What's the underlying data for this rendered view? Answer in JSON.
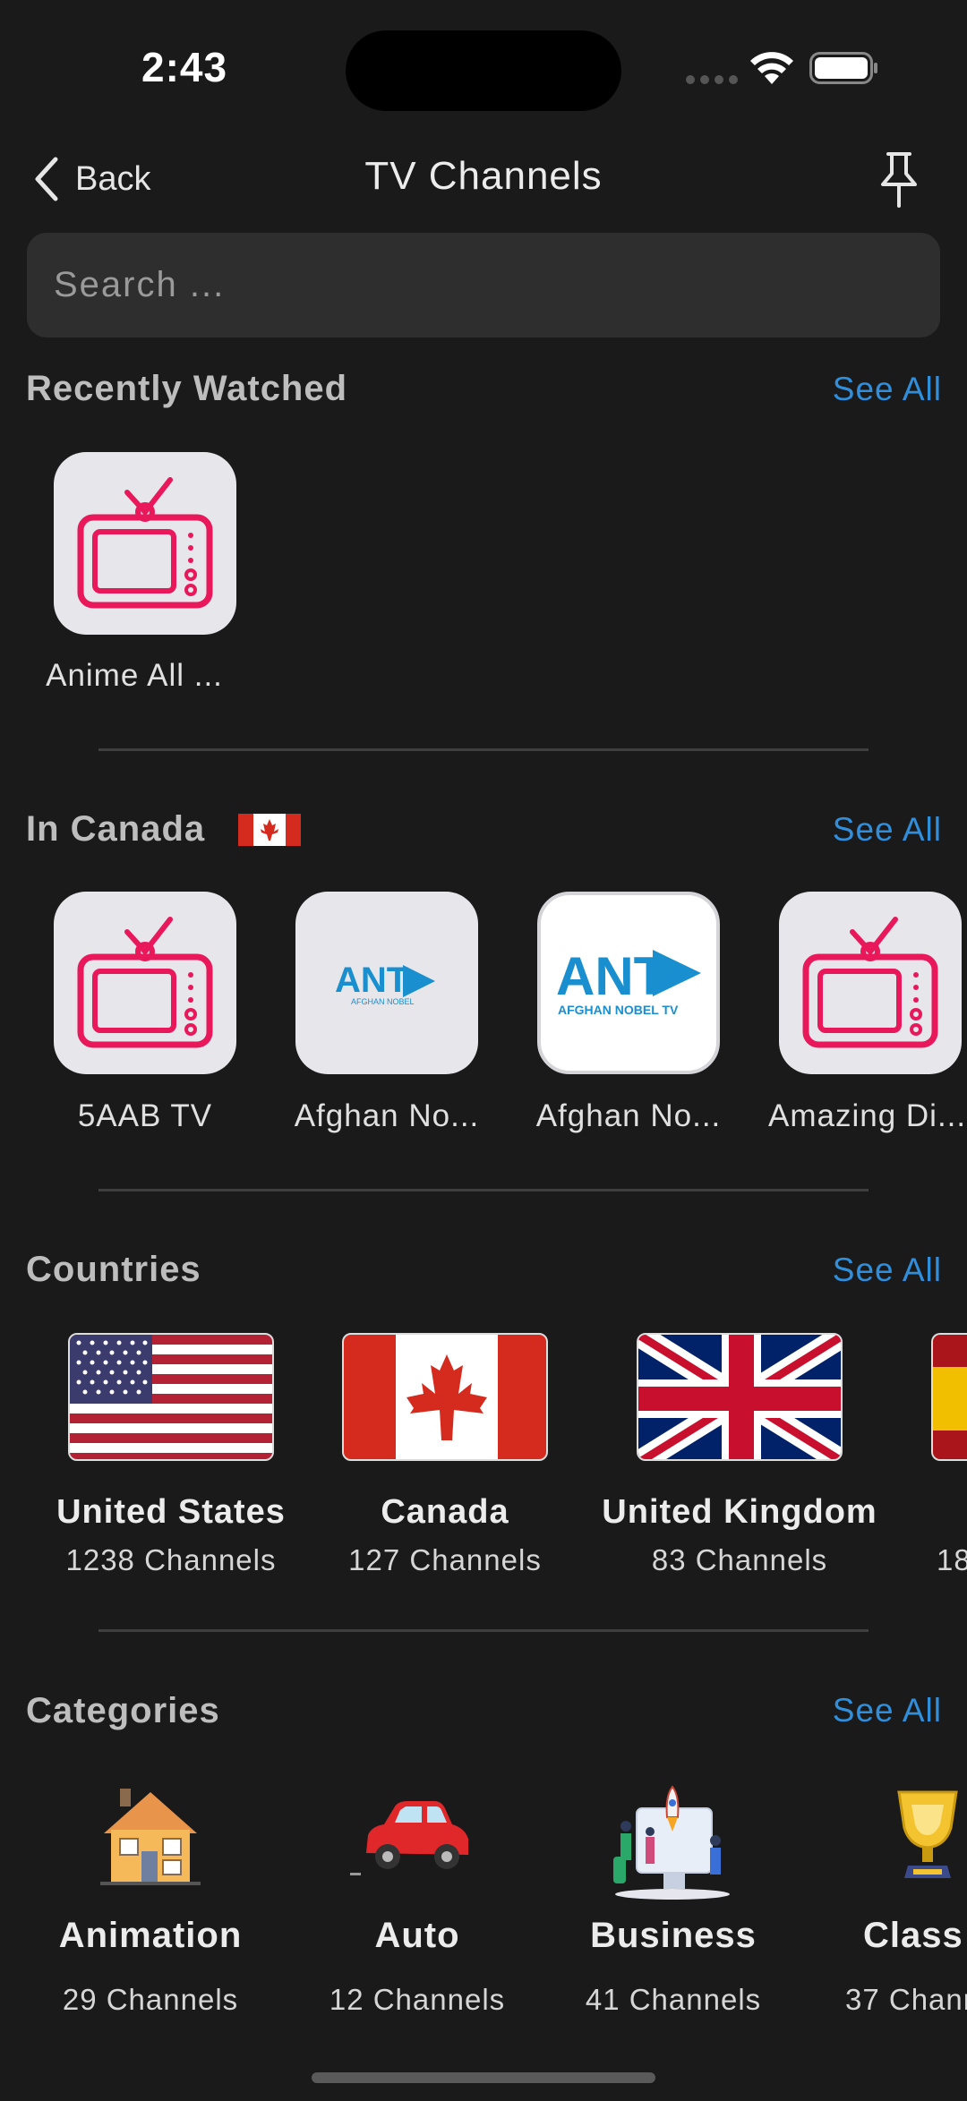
{
  "status": {
    "time": "2:43"
  },
  "nav": {
    "back_label": "Back",
    "title": "TV Channels"
  },
  "search": {
    "placeholder": "Search ..."
  },
  "sections": {
    "recent": {
      "title": "Recently Watched",
      "see_all": "See All"
    },
    "local": {
      "title": "In Canada",
      "see_all": "See All"
    },
    "countries": {
      "title": "Countries",
      "see_all": "See All"
    },
    "categories": {
      "title": "Categories",
      "see_all": "See All"
    }
  },
  "recent_channels": [
    {
      "name": "Anime All ...",
      "icon": "tv-icon"
    }
  ],
  "local_channels": [
    {
      "name": "5AAB TV",
      "icon": "tv-icon"
    },
    {
      "name": "Afghan No...",
      "icon": "ant-logo",
      "logo_text": "ANT",
      "logo_sub": "AFGHAN NOBEL"
    },
    {
      "name": "Afghan No...",
      "icon": "ant-logo",
      "logo_text": "ANT",
      "logo_sub": "AFGHAN NOBEL TV"
    },
    {
      "name": "Amazing Di...",
      "icon": "tv-icon"
    }
  ],
  "countries": [
    {
      "name": "United States",
      "count": "1238 Channels",
      "flag": "us-flag"
    },
    {
      "name": "Canada",
      "count": "127 Channels",
      "flag": "canada-flag"
    },
    {
      "name": "United Kingdom",
      "count": "83 Channels",
      "flag": "uk-flag"
    },
    {
      "name": "",
      "count": "18",
      "flag": "spain-flag"
    }
  ],
  "categories": [
    {
      "name": "Animation",
      "count": "29 Channels",
      "icon": "house-icon"
    },
    {
      "name": "Auto",
      "count": "12 Channels",
      "icon": "car-icon"
    },
    {
      "name": "Business",
      "count": "41 Channels",
      "icon": "business-icon"
    },
    {
      "name": "Class",
      "count": "37 Chann",
      "icon": "trophy-icon"
    }
  ],
  "colors": {
    "accent": "#2f8fdc",
    "tv_icon": "#e8185a",
    "background": "#1a1a1a",
    "ant_blue": "#1a8fd0"
  }
}
